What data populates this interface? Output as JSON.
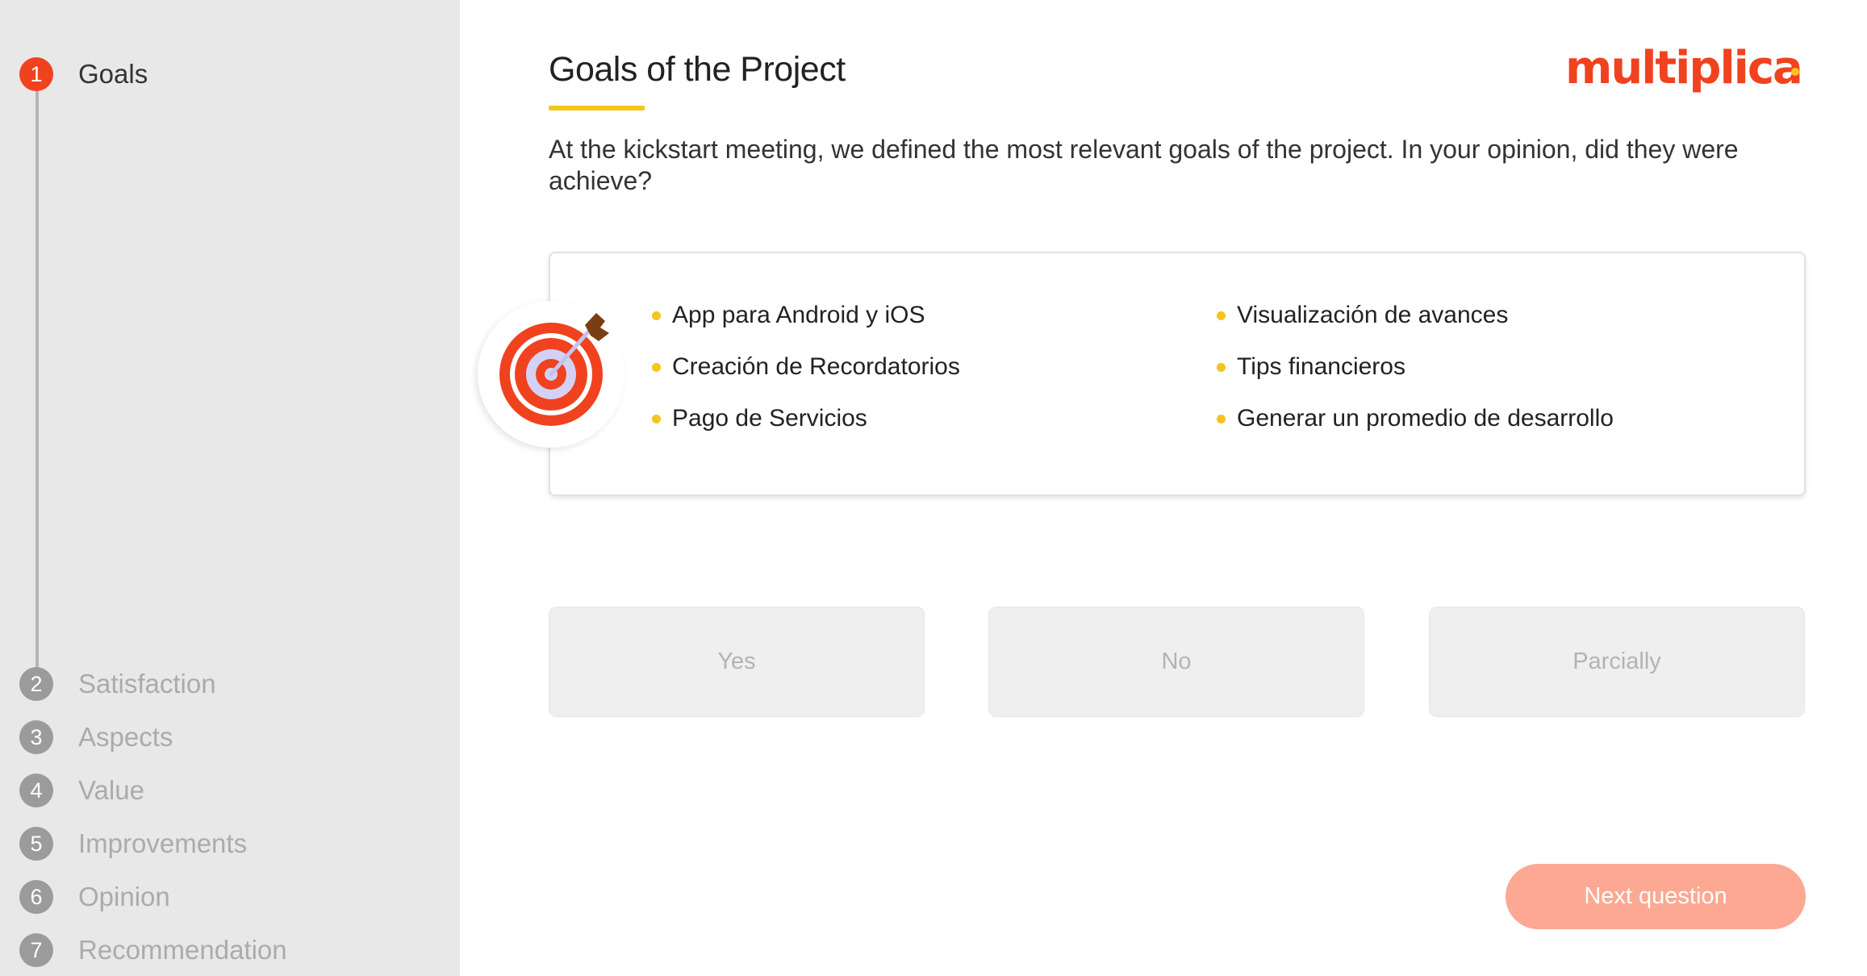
{
  "sidebar": {
    "steps": [
      {
        "number": "1",
        "label": "Goals",
        "active": true
      },
      {
        "number": "2",
        "label": "Satisfaction",
        "active": false
      },
      {
        "number": "3",
        "label": "Aspects",
        "active": false
      },
      {
        "number": "4",
        "label": "Value",
        "active": false
      },
      {
        "number": "5",
        "label": "Improvements",
        "active": false
      },
      {
        "number": "6",
        "label": "Opinion",
        "active": false
      },
      {
        "number": "7",
        "label": "Recommendation",
        "active": false
      }
    ]
  },
  "header": {
    "title": "Goals of the Project",
    "logo_text": "Multiplica"
  },
  "question": {
    "text": "At the kickstart meeting, we defined the most relevant goals of the project. In your opinion, did they were achieve?"
  },
  "goals_card": {
    "icon": "target-icon",
    "items": [
      "App para Android y iOS",
      "Creación de Recordatorios",
      "Pago de Servicios",
      "Visualización de avances",
      "Tips financieros",
      "Generar un promedio de desarrollo"
    ]
  },
  "answers": {
    "yes": "Yes",
    "no": "No",
    "partially": "Parcially"
  },
  "footer": {
    "next_label": "Next question"
  },
  "colors": {
    "accent": "#f0421f",
    "highlight": "#f5c51d",
    "next_button": "#fca892",
    "sidebar_bg": "#e8e8e8"
  }
}
